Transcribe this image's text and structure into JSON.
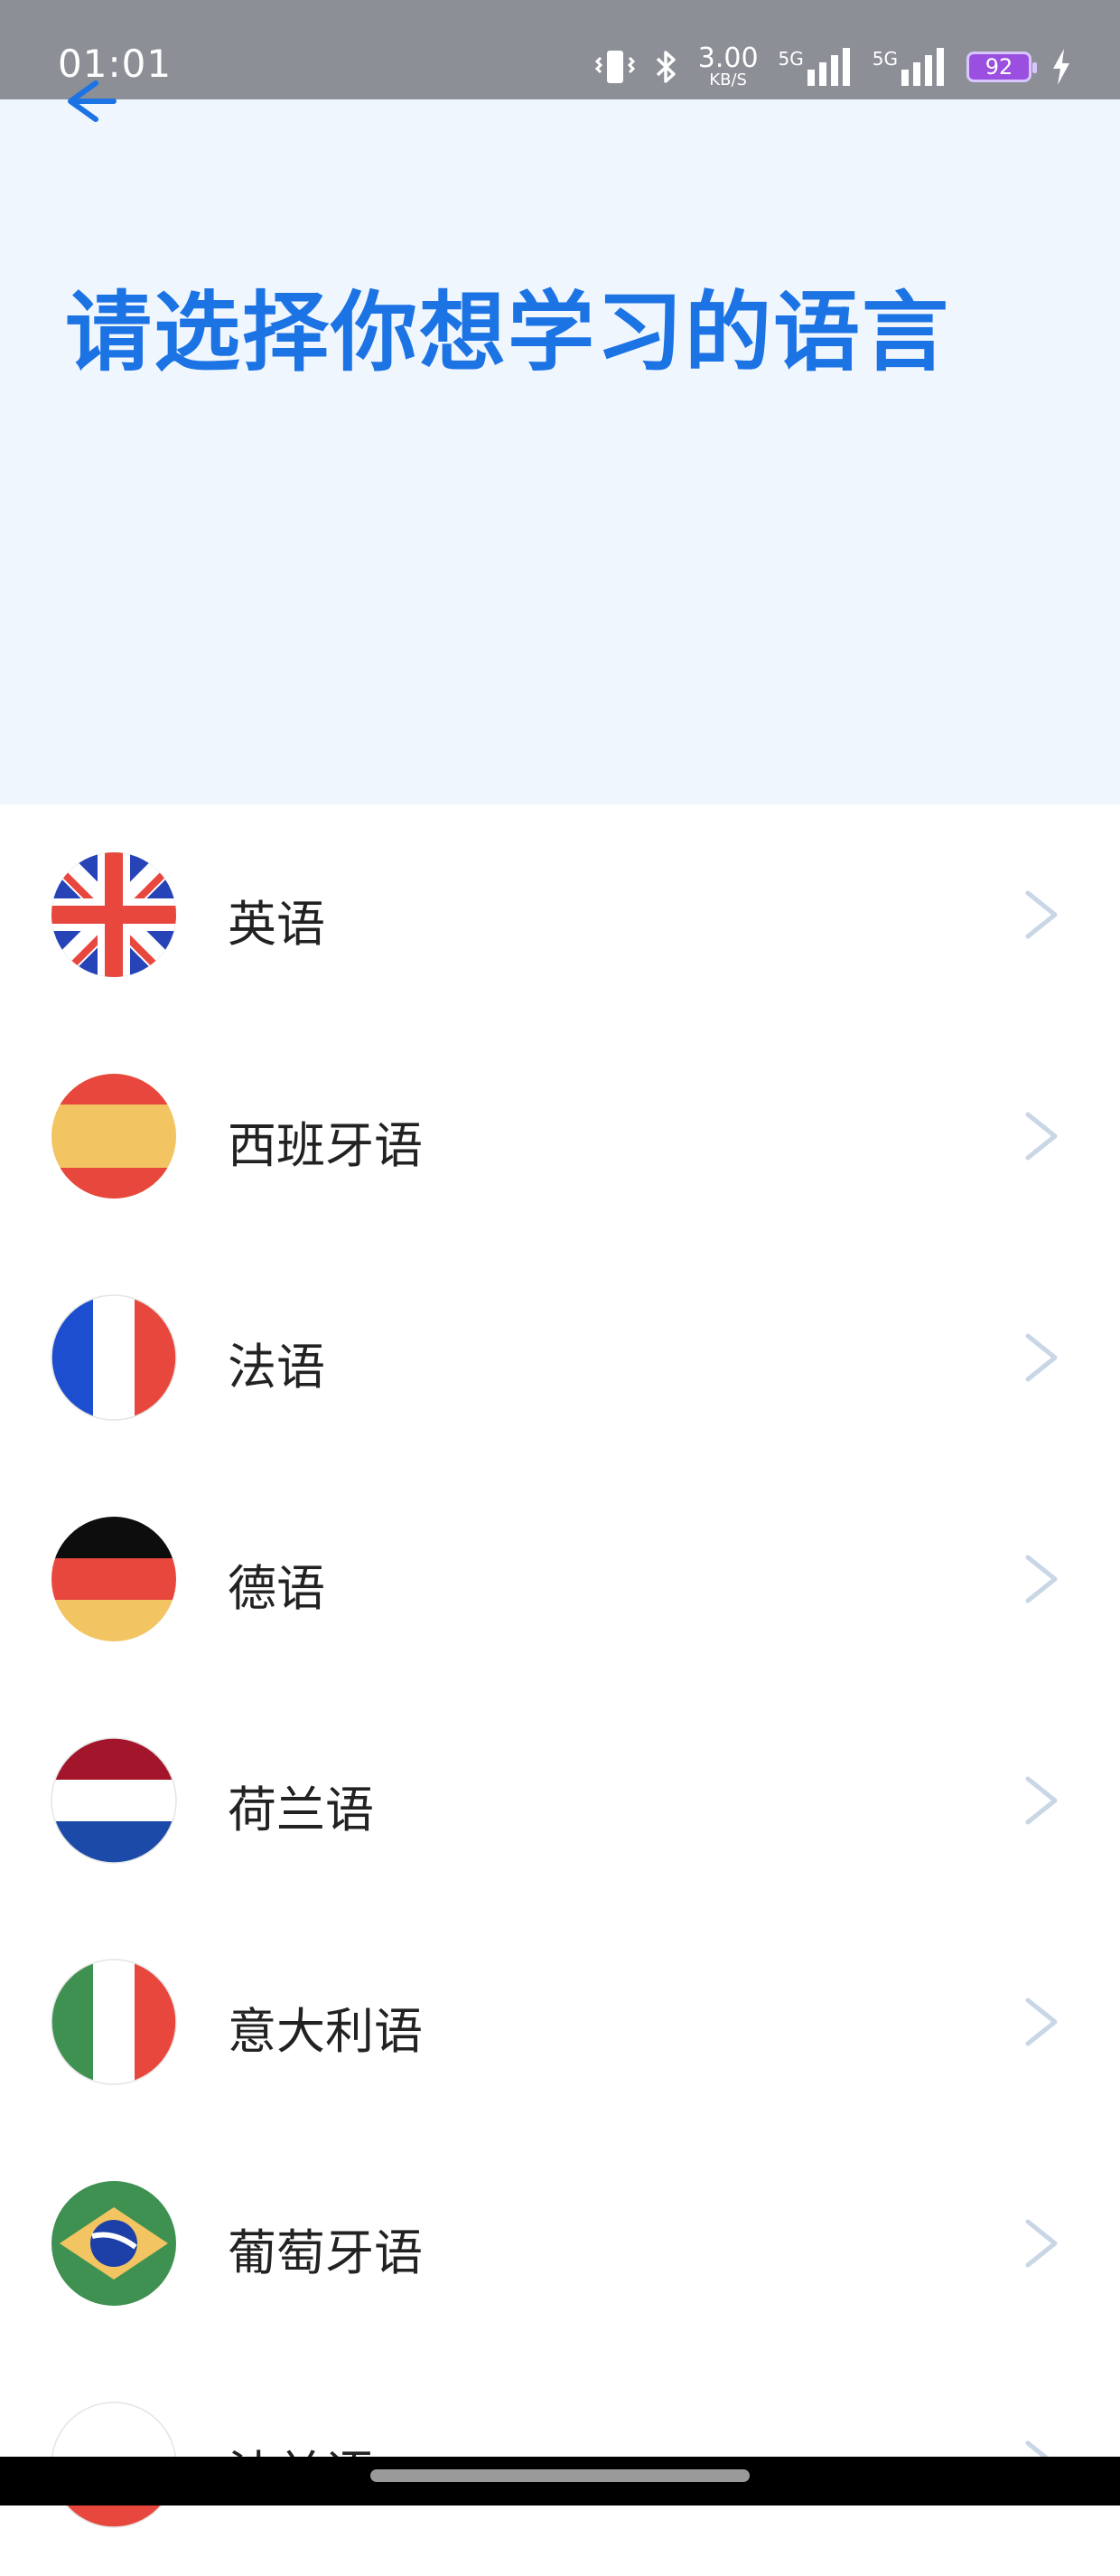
{
  "status_bar": {
    "time": "01:01",
    "net_speed_value": "3.00",
    "net_speed_unit": "KB/S",
    "network_1": "5G",
    "network_2": "5G",
    "battery": "92"
  },
  "header": {
    "title": "请选择你想学习的语言"
  },
  "languages": [
    {
      "label": "英语",
      "flag": "uk-flag-icon"
    },
    {
      "label": "西班牙语",
      "flag": "spain-flag-icon"
    },
    {
      "label": "法语",
      "flag": "france-flag-icon"
    },
    {
      "label": "德语",
      "flag": "germany-flag-icon"
    },
    {
      "label": "荷兰语",
      "flag": "netherlands-flag-icon"
    },
    {
      "label": "意大利语",
      "flag": "italy-flag-icon"
    },
    {
      "label": "葡萄牙语",
      "flag": "brazil-flag-icon"
    },
    {
      "label": "波兰语",
      "flag": "poland-flag-icon"
    }
  ],
  "colors": {
    "accent": "#1c73e4",
    "header_bg": "#eff6fe",
    "status_bar": "#8c9096",
    "chevron": "#c9d6e6"
  }
}
